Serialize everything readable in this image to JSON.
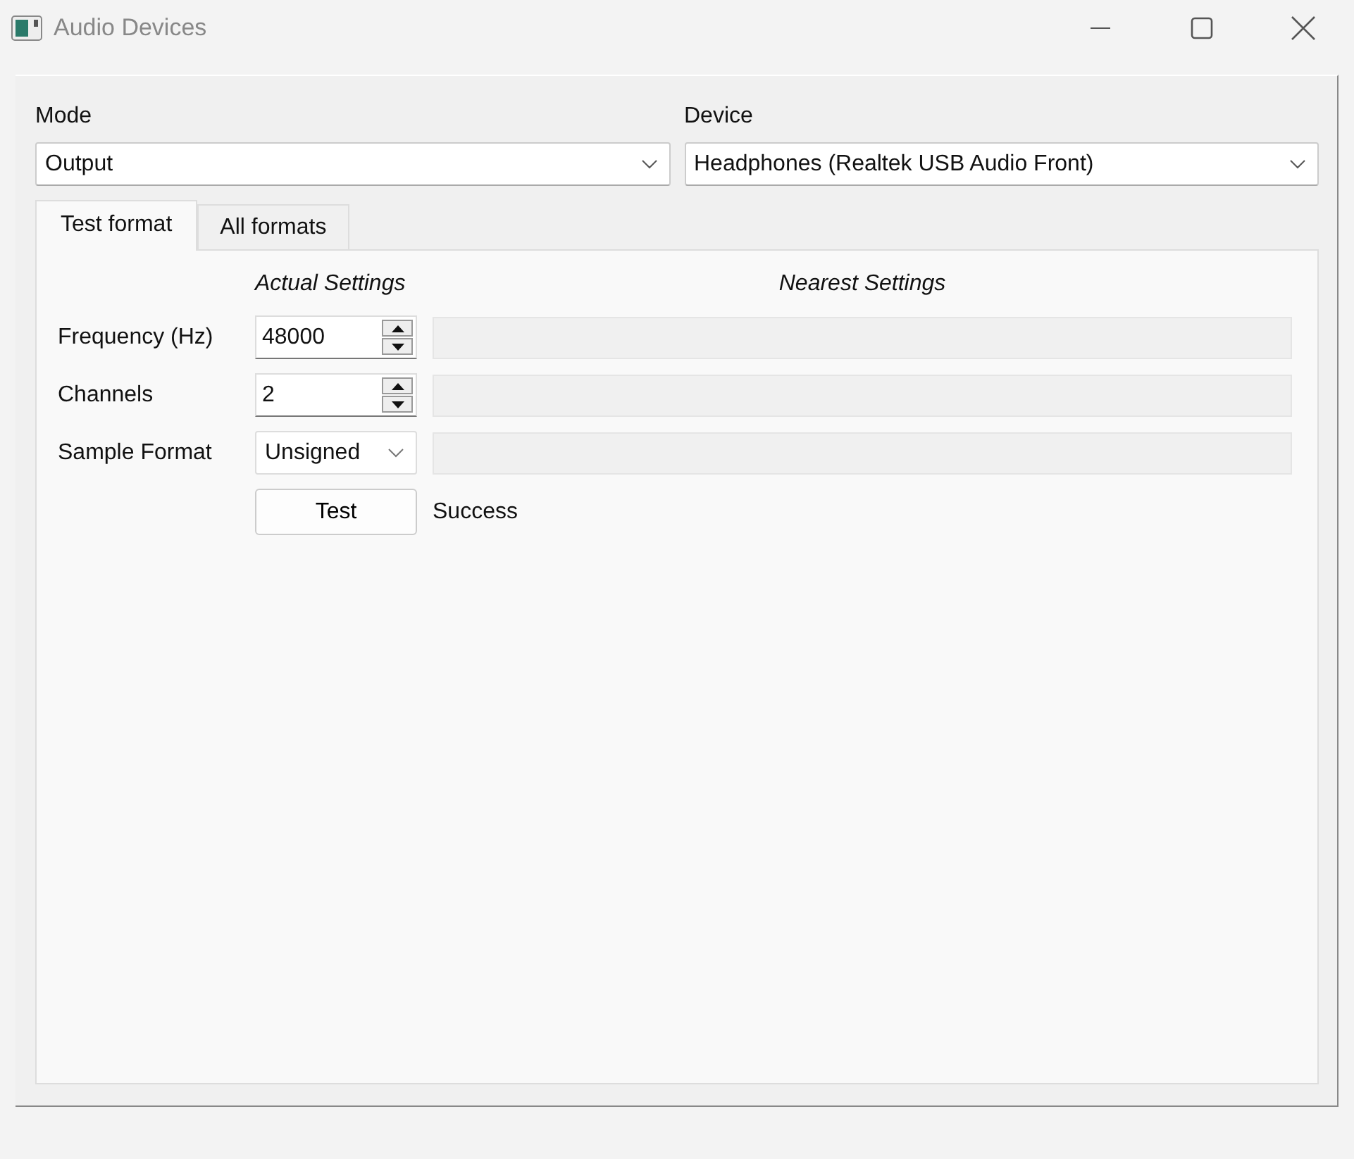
{
  "window": {
    "title": "Audio Devices"
  },
  "mode": {
    "label": "Mode",
    "value": "Output"
  },
  "device": {
    "label": "Device",
    "value": "Headphones (Realtek USB Audio Front)"
  },
  "tabs": [
    {
      "label": "Test format",
      "selected": true
    },
    {
      "label": "All formats",
      "selected": false
    }
  ],
  "test_format": {
    "actual_heading": "Actual Settings",
    "nearest_heading": "Nearest Settings",
    "rows": [
      {
        "label": "Frequency (Hz)",
        "kind": "spin",
        "value": "48000"
      },
      {
        "label": "Channels",
        "kind": "spin",
        "value": "2"
      },
      {
        "label": "Sample Format",
        "kind": "combo",
        "value": "Unsigned"
      }
    ],
    "test_button": "Test",
    "result": "Success"
  }
}
